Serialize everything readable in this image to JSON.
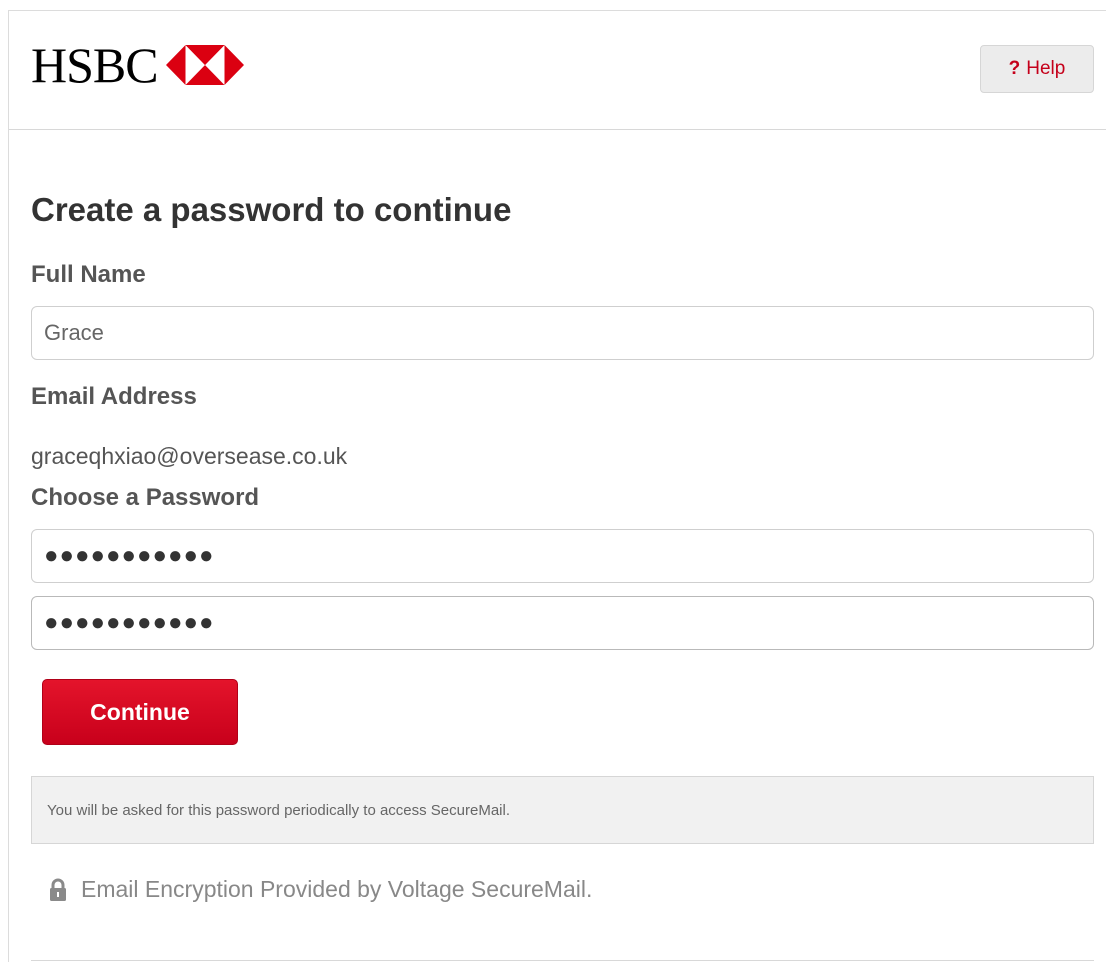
{
  "header": {
    "brand": "HSBC",
    "help_label": "Help",
    "help_mark": "?"
  },
  "form": {
    "title": "Create a password to continue",
    "full_name_label": "Full Name",
    "full_name_value": "Grace",
    "email_label": "Email Address",
    "email_value": "graceqhxiao@oversease.co.uk",
    "password_label": "Choose a Password",
    "password_value": "●●●●●●●●●●●",
    "confirm_password_value": "●●●●●●●●●●●",
    "continue_label": "Continue"
  },
  "info": {
    "message": "You will be asked for this password periodically to access SecureMail."
  },
  "footer": {
    "note": "Email Encryption Provided by Voltage SecureMail."
  },
  "colors": {
    "brand_red": "#db0011",
    "help_text": "#c5001a"
  },
  "icons": {
    "lock": "lock-icon",
    "hexagon": "hsbc-hexagon-logo"
  }
}
